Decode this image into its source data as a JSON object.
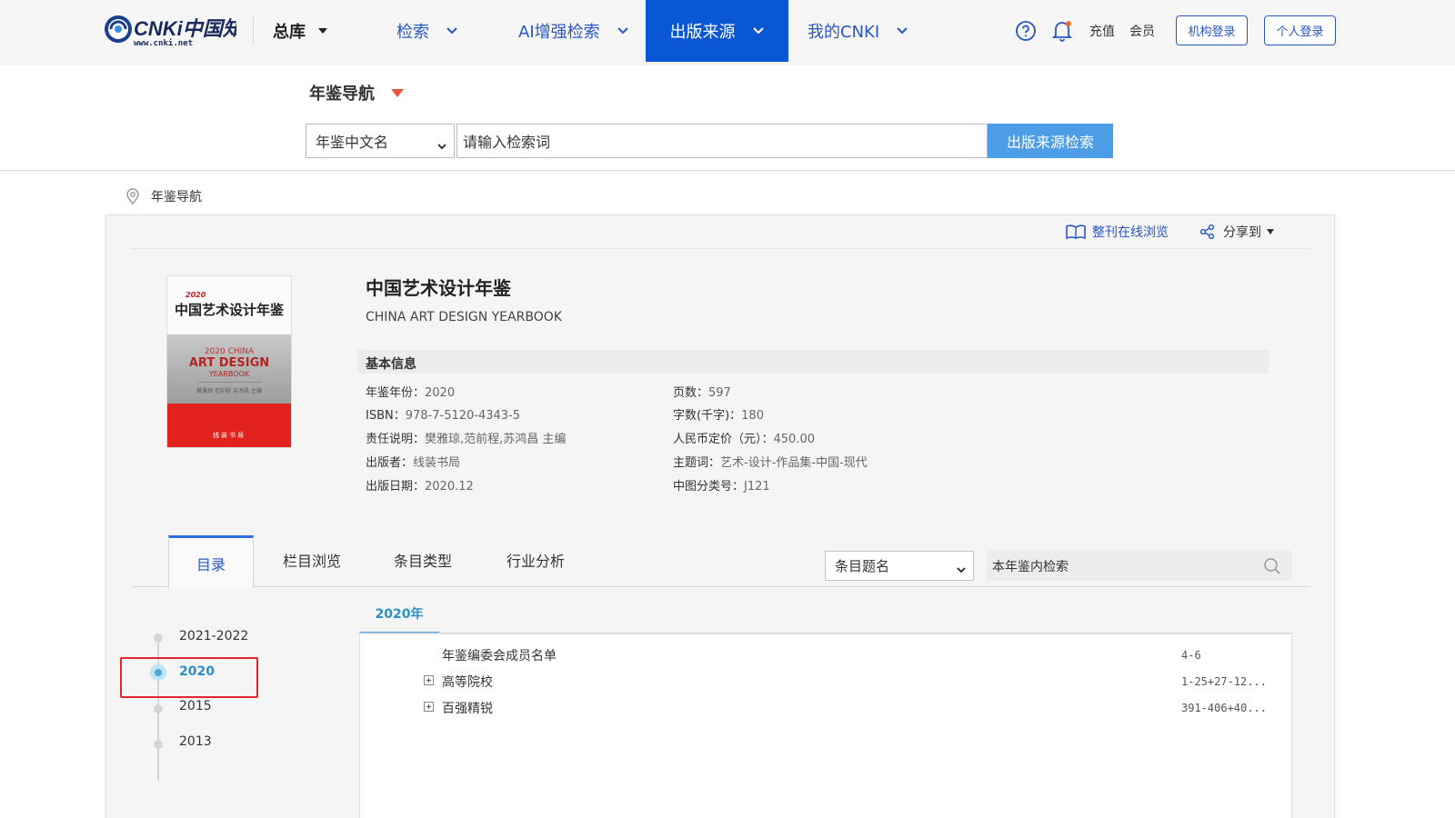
{
  "header": {
    "logo_text": "CNKi中国知网",
    "logo_url_text": "www.cnki.net",
    "nav": {
      "zongku": "总库",
      "jiansuo": "检索",
      "ai": "AI增强检索",
      "chuban": "出版来源",
      "mycnki": "我的CNKI"
    },
    "links": {
      "chongzhi": "充值",
      "huiyuan": "会员"
    },
    "buttons": {
      "jigou_login": "机构登录",
      "geren_login": "个人登录"
    },
    "colors": {
      "accent": "#0a57d6",
      "link": "#2856c6"
    }
  },
  "search": {
    "nav_title": "年鉴导航",
    "select_value": "年鉴中文名",
    "input_value": "请输入检索词",
    "button_label": "出版来源检索"
  },
  "breadcrumb": {
    "label": "年鉴导航"
  },
  "toolbar": {
    "browse_label": "整刊在线浏览",
    "share_label": "分享到"
  },
  "cover": {
    "year_badge": "2020",
    "cn_title": "中国艺术设计年鉴",
    "en_line1": "2020 CHINA",
    "en_line2": "ART DESIGN",
    "en_line3": "YEARBOOK",
    "editors": "樊雅琼 范前程 苏鸿昌 主编",
    "publisher": "线装书局"
  },
  "book": {
    "title": "中国艺术设计年鉴",
    "subtitle": "CHINA ART DESIGN YEARBOOK",
    "info_header": "基本信息",
    "info_left": [
      {
        "label": "年鉴年份：",
        "value": "2020"
      },
      {
        "label": "ISBN：",
        "value": "978-7-5120-4343-5"
      },
      {
        "label": "责任说明：",
        "value": "樊雅琼,范前程,苏鸿昌 主编"
      },
      {
        "label": "出版者：",
        "value": "线装书局"
      },
      {
        "label": "出版日期：",
        "value": "2020.12"
      }
    ],
    "info_right": [
      {
        "label": "页数：",
        "value": "597"
      },
      {
        "label": "字数(千字)：",
        "value": "180"
      },
      {
        "label": "人民币定价（元）：",
        "value": "450.00"
      },
      {
        "label": "主题词：",
        "value": "艺术-设计-作品集-中国-现代"
      },
      {
        "label": "中图分类号：",
        "value": "J121"
      }
    ]
  },
  "tabs": {
    "items": [
      "目录",
      "栏目浏览",
      "条目类型",
      "行业分析"
    ],
    "select_value": "条目题名",
    "search_placeholder": "本年鉴内检索"
  },
  "timeline": {
    "years": [
      "2021-2022",
      "2020",
      "2015",
      "2013"
    ],
    "active_year": "2020"
  },
  "content": {
    "panel_tab": "2020年",
    "entries": [
      {
        "title": "年鉴编委会成员名单",
        "pages": "4-6",
        "expandable": false
      },
      {
        "title": "高等院校",
        "pages": "1-25+27-12...",
        "expandable": true
      },
      {
        "title": "百强精锐",
        "pages": "391-406+40...",
        "expandable": true
      }
    ]
  }
}
